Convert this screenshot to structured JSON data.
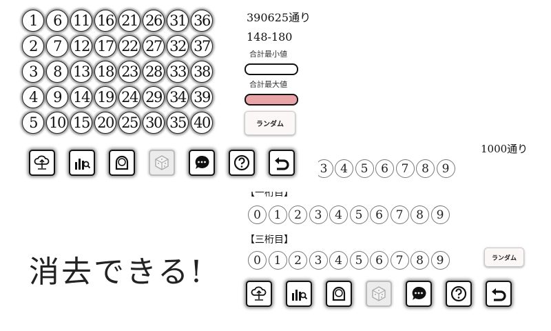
{
  "picker": {
    "numbers": [
      "1",
      "6",
      "11",
      "16",
      "21",
      "26",
      "31",
      "36",
      "2",
      "7",
      "12",
      "17",
      "22",
      "27",
      "32",
      "37",
      "3",
      "8",
      "13",
      "18",
      "23",
      "28",
      "33",
      "38",
      "4",
      "9",
      "14",
      "19",
      "24",
      "29",
      "34",
      "39",
      "5",
      "10",
      "15",
      "20",
      "25",
      "30",
      "35",
      "40"
    ]
  },
  "summary": {
    "combinations": "390625通り",
    "sum_range": "148-180",
    "min_label": "合計最小値",
    "max_label": "合計最大値",
    "random_label": "ランダム"
  },
  "digits": {
    "combinations": "1000通り",
    "row1_label": "【一桁目】",
    "row3_label": "【三桁目】",
    "values": [
      "0",
      "1",
      "2",
      "3",
      "4",
      "5",
      "6",
      "7",
      "8",
      "9"
    ],
    "random_label": "ランダム"
  },
  "toolbar_icons": [
    "cloud-upload-icon",
    "chart-search-icon",
    "bell-icon",
    "dice-icon",
    "chat-icon",
    "help-icon",
    "undo-icon"
  ],
  "caption": "消去できる!",
  "colors": {
    "max_bar": "#e8a4a6"
  }
}
